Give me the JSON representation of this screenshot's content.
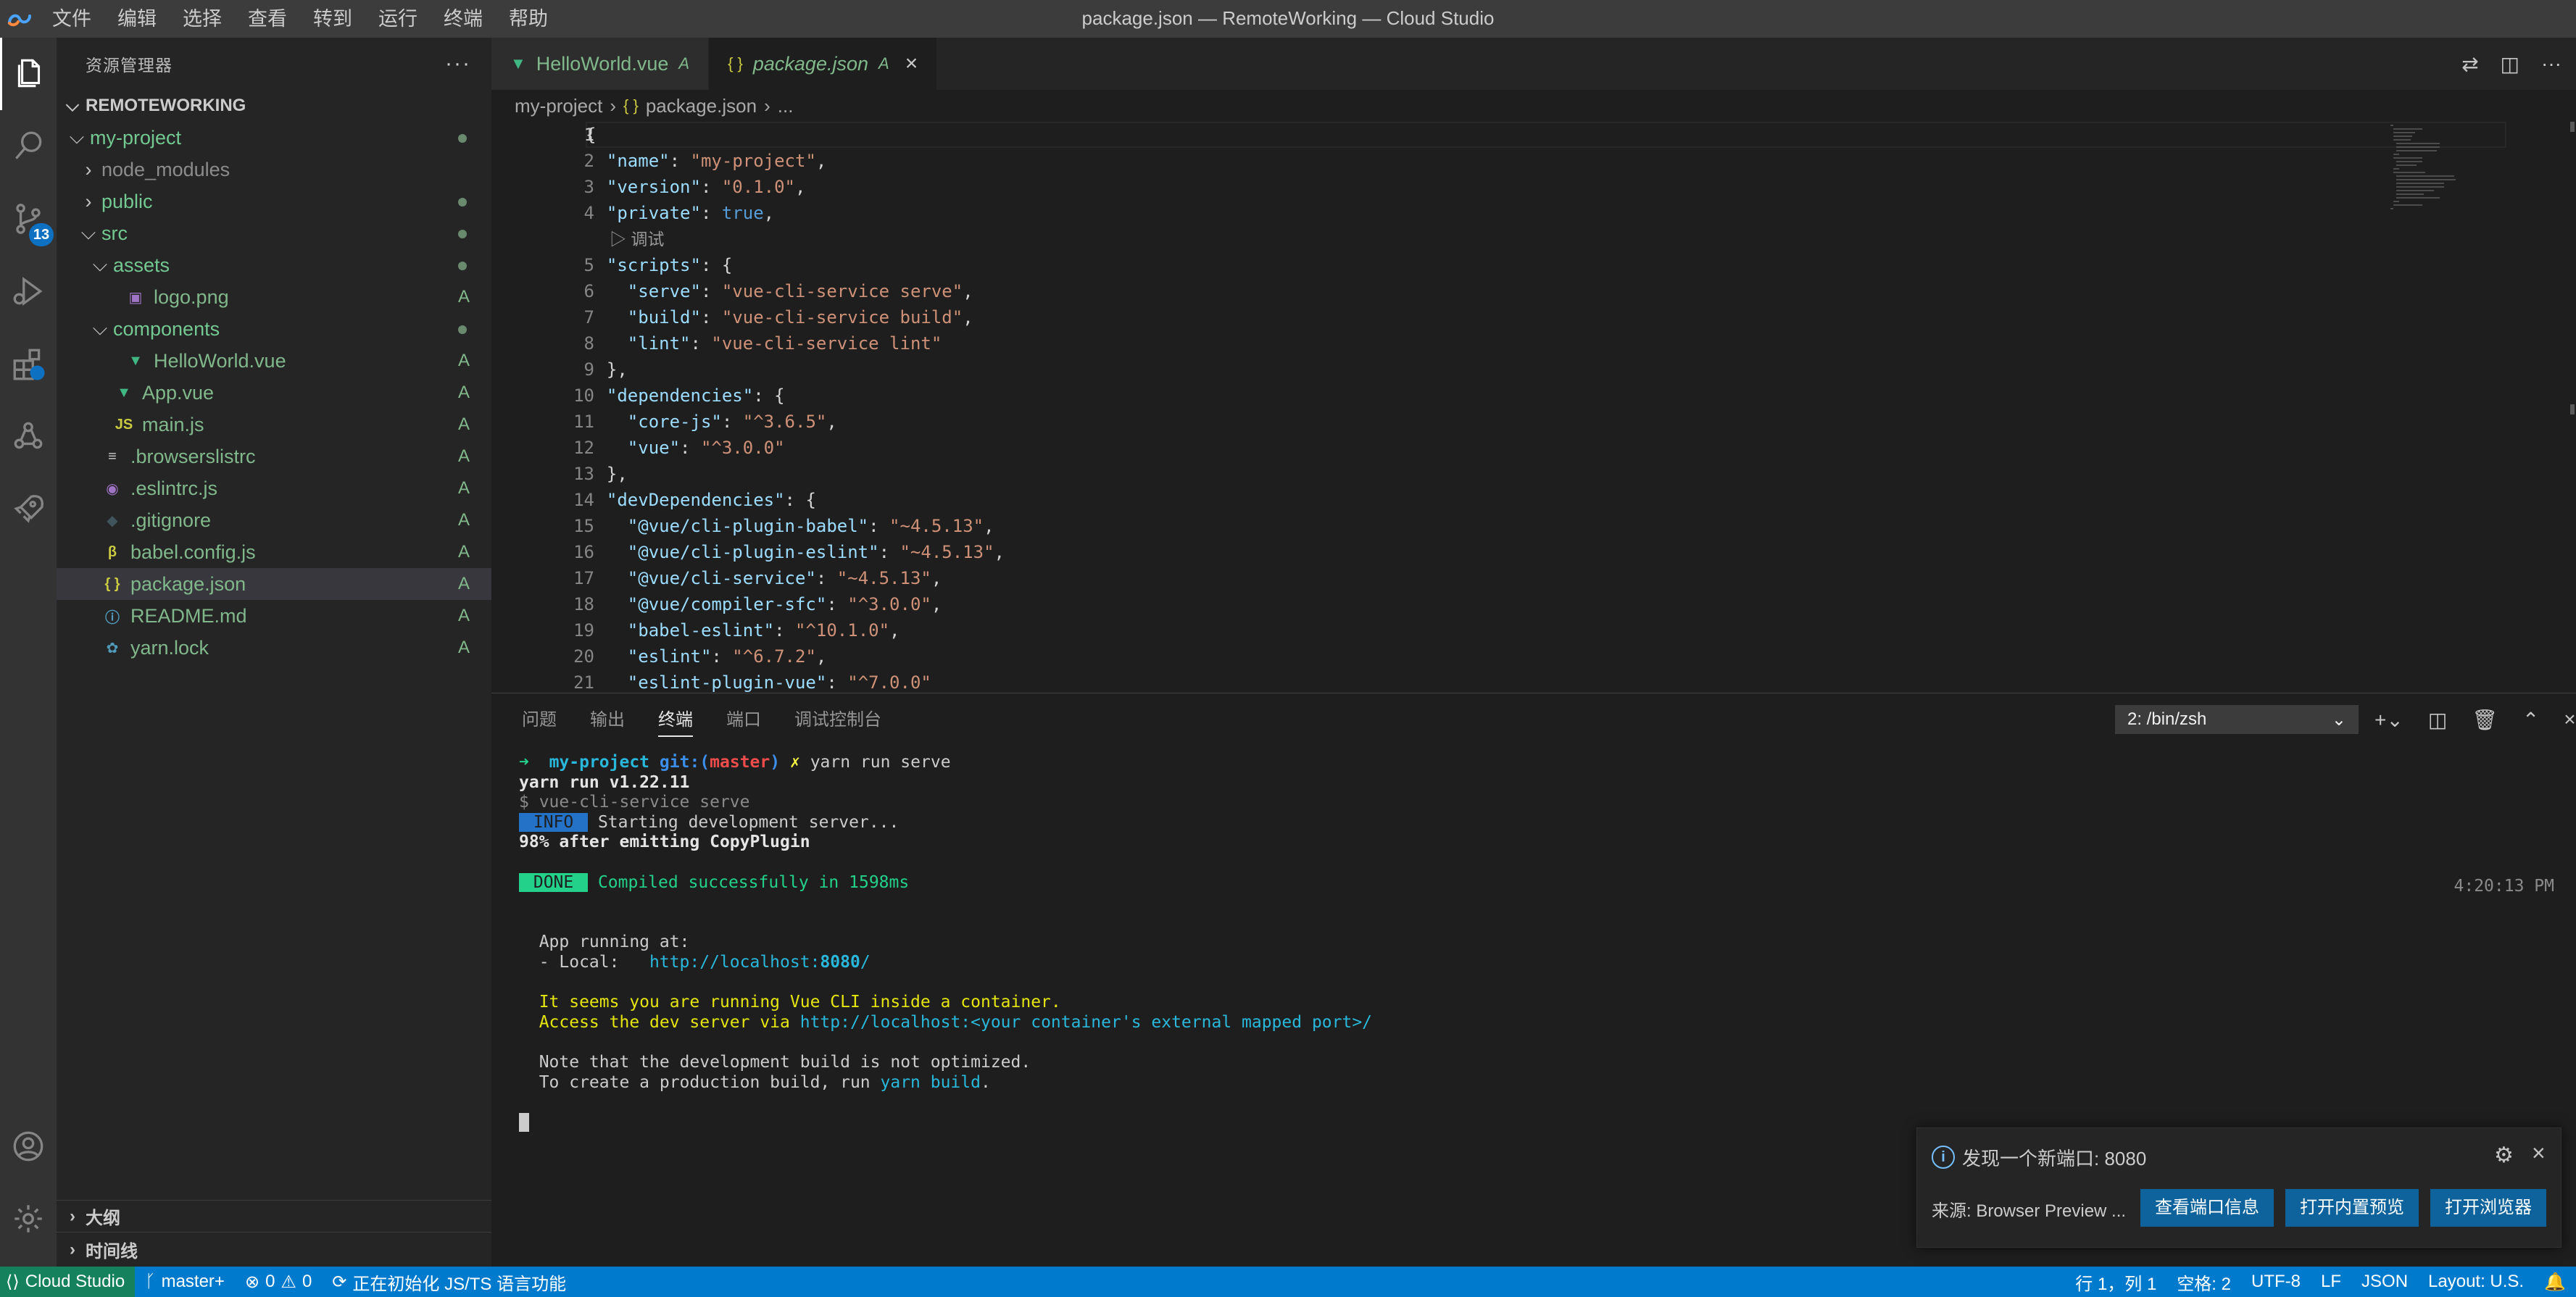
{
  "window": {
    "title": "package.json — RemoteWorking — Cloud Studio"
  },
  "menu": [
    "文件",
    "编辑",
    "选择",
    "查看",
    "转到",
    "运行",
    "终端",
    "帮助"
  ],
  "activity": {
    "scm_badge": "13"
  },
  "sidebar": {
    "title": "资源管理器",
    "more": "···",
    "workspace": "REMOTEWORKING",
    "tree": [
      {
        "label": "my-project",
        "depth": 0,
        "kind": "folder-open",
        "marker": "dot",
        "style": "git-mod"
      },
      {
        "label": "node_modules",
        "depth": 1,
        "kind": "folder",
        "marker": "",
        "style": "ignored"
      },
      {
        "label": "public",
        "depth": 1,
        "kind": "folder",
        "marker": "dot",
        "style": "git-mod"
      },
      {
        "label": "src",
        "depth": 1,
        "kind": "folder-open",
        "marker": "dot",
        "style": "git-mod"
      },
      {
        "label": "assets",
        "depth": 2,
        "kind": "folder-open",
        "marker": "dot",
        "style": "git-mod"
      },
      {
        "label": "logo.png",
        "depth": 3,
        "kind": "image",
        "marker": "A",
        "style": "git-added"
      },
      {
        "label": "components",
        "depth": 2,
        "kind": "folder-open",
        "marker": "dot",
        "style": "git-mod"
      },
      {
        "label": "HelloWorld.vue",
        "depth": 3,
        "kind": "vue",
        "marker": "A",
        "style": "git-added"
      },
      {
        "label": "App.vue",
        "depth": 2,
        "kind": "vue",
        "marker": "A",
        "style": "git-added"
      },
      {
        "label": "main.js",
        "depth": 2,
        "kind": "js",
        "marker": "A",
        "style": "git-added"
      },
      {
        "label": ".browserslistrc",
        "depth": 1,
        "kind": "lines",
        "marker": "A",
        "style": "git-added"
      },
      {
        "label": ".eslintrc.js",
        "depth": 1,
        "kind": "eslint",
        "marker": "A",
        "style": "git-added"
      },
      {
        "label": ".gitignore",
        "depth": 1,
        "kind": "git",
        "marker": "A",
        "style": "git-added"
      },
      {
        "label": "babel.config.js",
        "depth": 1,
        "kind": "babel",
        "marker": "A",
        "style": "git-added"
      },
      {
        "label": "package.json",
        "depth": 1,
        "kind": "json",
        "marker": "A",
        "style": "git-added",
        "selected": true
      },
      {
        "label": "README.md",
        "depth": 1,
        "kind": "info",
        "marker": "A",
        "style": "git-added"
      },
      {
        "label": "yarn.lock",
        "depth": 1,
        "kind": "yarn",
        "marker": "A",
        "style": "git-added"
      }
    ],
    "outline": "大纲",
    "timeline": "时间线"
  },
  "tabs": [
    {
      "icon": "vue",
      "label": "HelloWorld.vue",
      "badge": "A",
      "active": false
    },
    {
      "icon": "json",
      "label": "package.json",
      "badge": "A",
      "active": true,
      "close": "×"
    }
  ],
  "breadcrumb": {
    "folder": "my-project",
    "file": "package.json",
    "more": "..."
  },
  "code": {
    "codelens": "调试",
    "lines": [
      [
        {
          "t": "{",
          "c": "p"
        }
      ],
      [
        {
          "t": "  ",
          "c": "p"
        },
        {
          "t": "\"name\"",
          "c": "k"
        },
        {
          "t": ": ",
          "c": "p"
        },
        {
          "t": "\"my-project\"",
          "c": "s"
        },
        {
          "t": ",",
          "c": "p"
        }
      ],
      [
        {
          "t": "  ",
          "c": "p"
        },
        {
          "t": "\"version\"",
          "c": "k"
        },
        {
          "t": ": ",
          "c": "p"
        },
        {
          "t": "\"0.1.0\"",
          "c": "s"
        },
        {
          "t": ",",
          "c": "p"
        }
      ],
      [
        {
          "t": "  ",
          "c": "p"
        },
        {
          "t": "\"private\"",
          "c": "k"
        },
        {
          "t": ": ",
          "c": "p"
        },
        {
          "t": "true",
          "c": "b"
        },
        {
          "t": ",",
          "c": "p"
        }
      ],
      [
        {
          "t": "  ",
          "c": "p"
        },
        {
          "t": "\"scripts\"",
          "c": "k"
        },
        {
          "t": ": {",
          "c": "p"
        }
      ],
      [
        {
          "t": "    ",
          "c": "p"
        },
        {
          "t": "\"serve\"",
          "c": "k"
        },
        {
          "t": ": ",
          "c": "p"
        },
        {
          "t": "\"vue-cli-service serve\"",
          "c": "s"
        },
        {
          "t": ",",
          "c": "p"
        }
      ],
      [
        {
          "t": "    ",
          "c": "p"
        },
        {
          "t": "\"build\"",
          "c": "k"
        },
        {
          "t": ": ",
          "c": "p"
        },
        {
          "t": "\"vue-cli-service build\"",
          "c": "s"
        },
        {
          "t": ",",
          "c": "p"
        }
      ],
      [
        {
          "t": "    ",
          "c": "p"
        },
        {
          "t": "\"lint\"",
          "c": "k"
        },
        {
          "t": ": ",
          "c": "p"
        },
        {
          "t": "\"vue-cli-service lint\"",
          "c": "s"
        }
      ],
      [
        {
          "t": "  },",
          "c": "p"
        }
      ],
      [
        {
          "t": "  ",
          "c": "p"
        },
        {
          "t": "\"dependencies\"",
          "c": "k"
        },
        {
          "t": ": {",
          "c": "p"
        }
      ],
      [
        {
          "t": "    ",
          "c": "p"
        },
        {
          "t": "\"core-js\"",
          "c": "k"
        },
        {
          "t": ": ",
          "c": "p"
        },
        {
          "t": "\"^3.6.5\"",
          "c": "s"
        },
        {
          "t": ",",
          "c": "p"
        }
      ],
      [
        {
          "t": "    ",
          "c": "p"
        },
        {
          "t": "\"vue\"",
          "c": "k"
        },
        {
          "t": ": ",
          "c": "p"
        },
        {
          "t": "\"^3.0.0\"",
          "c": "s"
        }
      ],
      [
        {
          "t": "  },",
          "c": "p"
        }
      ],
      [
        {
          "t": "  ",
          "c": "p"
        },
        {
          "t": "\"devDependencies\"",
          "c": "k"
        },
        {
          "t": ": {",
          "c": "p"
        }
      ],
      [
        {
          "t": "    ",
          "c": "p"
        },
        {
          "t": "\"@vue/cli-plugin-babel\"",
          "c": "k"
        },
        {
          "t": ": ",
          "c": "p"
        },
        {
          "t": "\"~4.5.13\"",
          "c": "s"
        },
        {
          "t": ",",
          "c": "p"
        }
      ],
      [
        {
          "t": "    ",
          "c": "p"
        },
        {
          "t": "\"@vue/cli-plugin-eslint\"",
          "c": "k"
        },
        {
          "t": ": ",
          "c": "p"
        },
        {
          "t": "\"~4.5.13\"",
          "c": "s"
        },
        {
          "t": ",",
          "c": "p"
        }
      ],
      [
        {
          "t": "    ",
          "c": "p"
        },
        {
          "t": "\"@vue/cli-service\"",
          "c": "k"
        },
        {
          "t": ": ",
          "c": "p"
        },
        {
          "t": "\"~4.5.13\"",
          "c": "s"
        },
        {
          "t": ",",
          "c": "p"
        }
      ],
      [
        {
          "t": "    ",
          "c": "p"
        },
        {
          "t": "\"@vue/compiler-sfc\"",
          "c": "k"
        },
        {
          "t": ": ",
          "c": "p"
        },
        {
          "t": "\"^3.0.0\"",
          "c": "s"
        },
        {
          "t": ",",
          "c": "p"
        }
      ],
      [
        {
          "t": "    ",
          "c": "p"
        },
        {
          "t": "\"babel-eslint\"",
          "c": "k"
        },
        {
          "t": ": ",
          "c": "p"
        },
        {
          "t": "\"^10.1.0\"",
          "c": "s"
        },
        {
          "t": ",",
          "c": "p"
        }
      ],
      [
        {
          "t": "    ",
          "c": "p"
        },
        {
          "t": "\"eslint\"",
          "c": "k"
        },
        {
          "t": ": ",
          "c": "p"
        },
        {
          "t": "\"^6.7.2\"",
          "c": "s"
        },
        {
          "t": ",",
          "c": "p"
        }
      ],
      [
        {
          "t": "    ",
          "c": "p"
        },
        {
          "t": "\"eslint-plugin-vue\"",
          "c": "k"
        },
        {
          "t": ": ",
          "c": "p"
        },
        {
          "t": "\"^7.0.0\"",
          "c": "s"
        }
      ]
    ]
  },
  "panel": {
    "tabs": [
      "问题",
      "输出",
      "终端",
      "端口",
      "调试控制台"
    ],
    "active_tab": "终端",
    "terminal_select": "2: /bin/zsh"
  },
  "terminal": {
    "prompt_arrow": "➜",
    "prompt_dir": "my-project",
    "prompt_git": "git:(",
    "prompt_branch": "master",
    "prompt_git_close": ")",
    "prompt_x": "✗",
    "command": "yarn run serve",
    "yarn_version": "yarn run v1.22.11",
    "cli_cmd": "$ vue-cli-service serve",
    "info_badge": " INFO ",
    "info_text": " Starting development server...",
    "progress": "98% after emitting CopyPlugin",
    "done_badge": " DONE ",
    "done_text": " Compiled successfully in 1598ms",
    "time": "4:20:13 PM",
    "running_at": "  App running at:",
    "local_label": "  - Local:   ",
    "local_url_prefix": "http://localhost:",
    "local_port": "8080",
    "local_url_suffix": "/",
    "container_warn": "  It seems you are running Vue CLI inside a container.",
    "access_prefix": "  Access the dev server via ",
    "access_url": "http://localhost:<your container's external mapped port>/",
    "note1": "  Note that the development build is not optimized.",
    "note2_prefix": "  To create a production build, run ",
    "note2_cmd": "yarn build",
    "note2_suffix": "."
  },
  "notification": {
    "message": "发现一个新端口: 8080",
    "source": "来源: Browser Preview ...",
    "buttons": [
      "查看端口信息",
      "打开内置预览",
      "打开浏览器"
    ]
  },
  "status": {
    "remote": "Cloud Studio",
    "branch": "master+",
    "errors": "0",
    "warnings": "0",
    "init": "正在初始化 JS/TS 语言功能",
    "position": "行 1，列 1",
    "spaces": "空格: 2",
    "encoding": "UTF-8",
    "eol": "LF",
    "language": "JSON",
    "layout": "Layout: U.S."
  }
}
